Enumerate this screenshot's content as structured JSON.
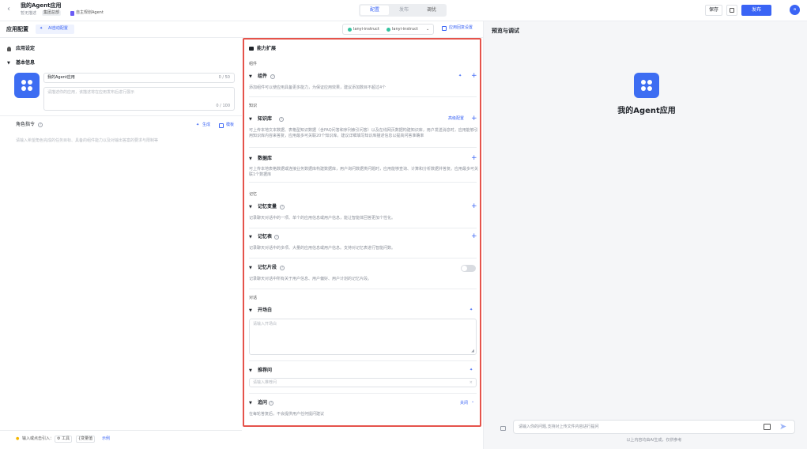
{
  "header": {
    "app_name": "我的Agent应用",
    "no_desc": "暂无描述",
    "team": "集团总部",
    "agent_type": "自主规划Agent",
    "tabs": [
      "配置",
      "发布",
      "调优"
    ],
    "save": "保存",
    "publish": "发布",
    "avatar": "a"
  },
  "subbar": {
    "title": "应用配置",
    "ai_config": "AI自动配置",
    "model1": "lanyi-instruct",
    "model2": "lanyi-instruct",
    "reply_settings": "应用回复设置"
  },
  "left": {
    "app_settings": "应用设定",
    "basic_info": "基本信息",
    "name_value": "我的Agent应用",
    "name_count": "0 / 50",
    "desc_placeholder": "请描述你的应用，该描述将在应用发布后进行展示",
    "desc_count": "0 / 100",
    "role_title": "角色指令",
    "generate": "生成",
    "template": "模板",
    "role_placeholder": "请输入希望角色完成的任务目标、具备的组件能力以及对输出答案的要求与限制等",
    "footer_hint": "输入或点击引入：",
    "tools": "工具",
    "variables": "{变量值",
    "example": "示例"
  },
  "mid": {
    "title": "能力扩展",
    "section_components": "组件",
    "components": "组件",
    "components_desc": "添加组件可以使应用具备更多能力，为保证应用效果，建议添加数目不超过4个",
    "section_knowledge": "知识",
    "kb": "知识库",
    "kb_advanced": "高级配置",
    "kb_desc": "可上传本地文本数据、表格型知识数据（含FAQ问答和序列索引问答）以及在线网页数据构建知识库，用户发送消息时，应用能够引用知识库内容来答复，应用最多可关联20个知识库。建议详细填写知识库描述信息以提高问答准确率",
    "db": "数据库",
    "db_desc": "可上传本地表格数据或连接业务数据库构建数据库，用户询问数据类问题时，应用能够查询、计算和分析数据并答复。应用最多可关联1个数据库",
    "section_memory": "记忆",
    "mem_var": "记忆变量",
    "mem_var_desc": "记录聊天对话中的一项、单个的应用信息或用户信息，能让智能体回答更加个性化。",
    "mem_table": "记忆表",
    "mem_table_desc": "记录聊天对话中的多项、大量的应用信息或用户信息。支持对记忆表进行智能问数。",
    "mem_snip": "记忆片段",
    "mem_snip_desc": "记录聊天对话中所有关于用户信息、用户偏好、用户计划的记忆片段。",
    "section_dialog": "对话",
    "opening": "开场白",
    "opening_placeholder": "请输入开场白",
    "recommend": "推荐问",
    "recommend_placeholder": "请输入推荐问",
    "followup": "追问",
    "followup_status": "关闭",
    "followup_desc": "在每轮答复后，不会提供用户任何提问建议"
  },
  "right": {
    "title": "预览与调试",
    "app_name": "我的Agent应用",
    "input_placeholder": "请输入你的问题,支持对上传文件内容进行提问",
    "disclaimer": "以上内容均由AI生成，仅供参考"
  },
  "colors": {
    "accent": "#3a64f5",
    "highlight": "#e5534b",
    "app_icon": "#3d6df2"
  }
}
